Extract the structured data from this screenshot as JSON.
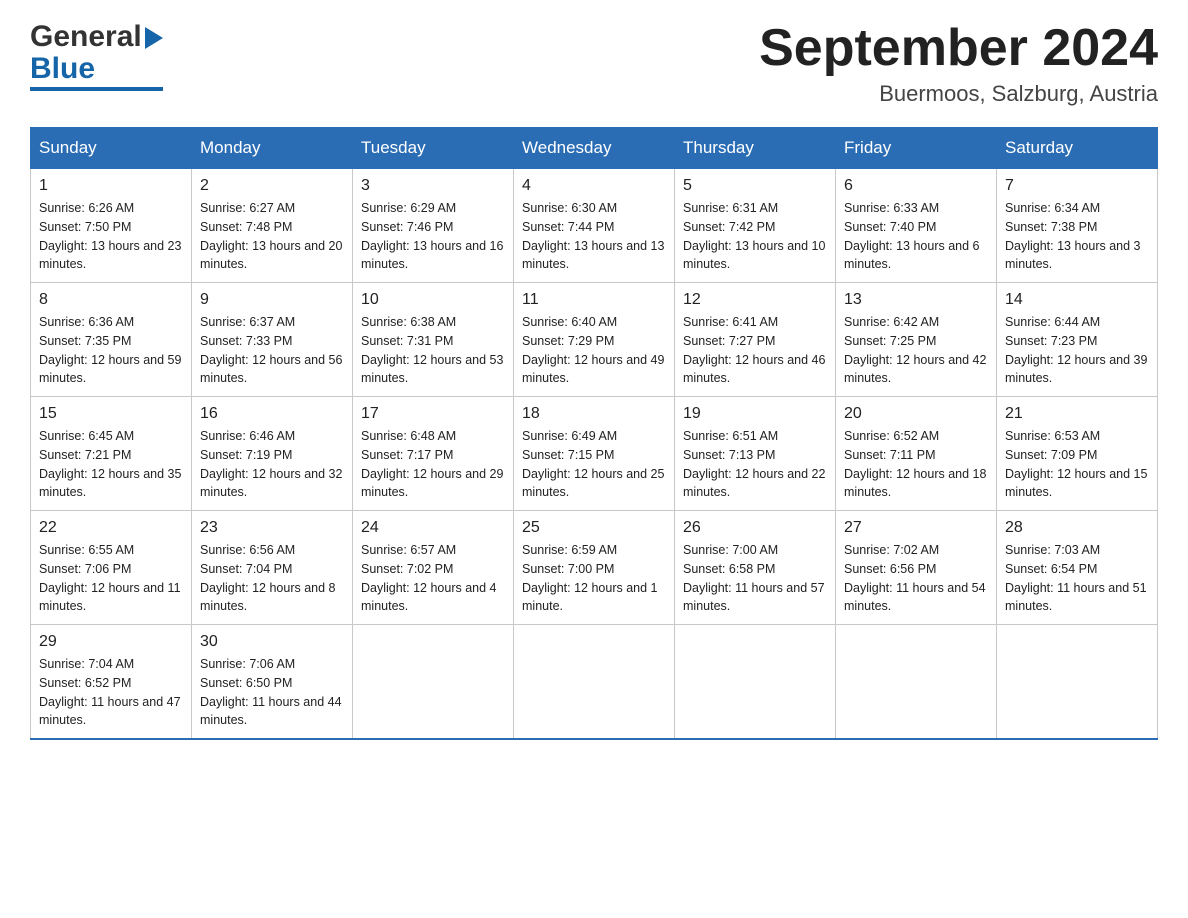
{
  "logo": {
    "general": "General",
    "blue": "Blue"
  },
  "title": "September 2024",
  "subtitle": "Buermoos, Salzburg, Austria",
  "days": [
    "Sunday",
    "Monday",
    "Tuesday",
    "Wednesday",
    "Thursday",
    "Friday",
    "Saturday"
  ],
  "weeks": [
    [
      {
        "num": "1",
        "sunrise": "6:26 AM",
        "sunset": "7:50 PM",
        "daylight": "13 hours and 23 minutes."
      },
      {
        "num": "2",
        "sunrise": "6:27 AM",
        "sunset": "7:48 PM",
        "daylight": "13 hours and 20 minutes."
      },
      {
        "num": "3",
        "sunrise": "6:29 AM",
        "sunset": "7:46 PM",
        "daylight": "13 hours and 16 minutes."
      },
      {
        "num": "4",
        "sunrise": "6:30 AM",
        "sunset": "7:44 PM",
        "daylight": "13 hours and 13 minutes."
      },
      {
        "num": "5",
        "sunrise": "6:31 AM",
        "sunset": "7:42 PM",
        "daylight": "13 hours and 10 minutes."
      },
      {
        "num": "6",
        "sunrise": "6:33 AM",
        "sunset": "7:40 PM",
        "daylight": "13 hours and 6 minutes."
      },
      {
        "num": "7",
        "sunrise": "6:34 AM",
        "sunset": "7:38 PM",
        "daylight": "13 hours and 3 minutes."
      }
    ],
    [
      {
        "num": "8",
        "sunrise": "6:36 AM",
        "sunset": "7:35 PM",
        "daylight": "12 hours and 59 minutes."
      },
      {
        "num": "9",
        "sunrise": "6:37 AM",
        "sunset": "7:33 PM",
        "daylight": "12 hours and 56 minutes."
      },
      {
        "num": "10",
        "sunrise": "6:38 AM",
        "sunset": "7:31 PM",
        "daylight": "12 hours and 53 minutes."
      },
      {
        "num": "11",
        "sunrise": "6:40 AM",
        "sunset": "7:29 PM",
        "daylight": "12 hours and 49 minutes."
      },
      {
        "num": "12",
        "sunrise": "6:41 AM",
        "sunset": "7:27 PM",
        "daylight": "12 hours and 46 minutes."
      },
      {
        "num": "13",
        "sunrise": "6:42 AM",
        "sunset": "7:25 PM",
        "daylight": "12 hours and 42 minutes."
      },
      {
        "num": "14",
        "sunrise": "6:44 AM",
        "sunset": "7:23 PM",
        "daylight": "12 hours and 39 minutes."
      }
    ],
    [
      {
        "num": "15",
        "sunrise": "6:45 AM",
        "sunset": "7:21 PM",
        "daylight": "12 hours and 35 minutes."
      },
      {
        "num": "16",
        "sunrise": "6:46 AM",
        "sunset": "7:19 PM",
        "daylight": "12 hours and 32 minutes."
      },
      {
        "num": "17",
        "sunrise": "6:48 AM",
        "sunset": "7:17 PM",
        "daylight": "12 hours and 29 minutes."
      },
      {
        "num": "18",
        "sunrise": "6:49 AM",
        "sunset": "7:15 PM",
        "daylight": "12 hours and 25 minutes."
      },
      {
        "num": "19",
        "sunrise": "6:51 AM",
        "sunset": "7:13 PM",
        "daylight": "12 hours and 22 minutes."
      },
      {
        "num": "20",
        "sunrise": "6:52 AM",
        "sunset": "7:11 PM",
        "daylight": "12 hours and 18 minutes."
      },
      {
        "num": "21",
        "sunrise": "6:53 AM",
        "sunset": "7:09 PM",
        "daylight": "12 hours and 15 minutes."
      }
    ],
    [
      {
        "num": "22",
        "sunrise": "6:55 AM",
        "sunset": "7:06 PM",
        "daylight": "12 hours and 11 minutes."
      },
      {
        "num": "23",
        "sunrise": "6:56 AM",
        "sunset": "7:04 PM",
        "daylight": "12 hours and 8 minutes."
      },
      {
        "num": "24",
        "sunrise": "6:57 AM",
        "sunset": "7:02 PM",
        "daylight": "12 hours and 4 minutes."
      },
      {
        "num": "25",
        "sunrise": "6:59 AM",
        "sunset": "7:00 PM",
        "daylight": "12 hours and 1 minute."
      },
      {
        "num": "26",
        "sunrise": "7:00 AM",
        "sunset": "6:58 PM",
        "daylight": "11 hours and 57 minutes."
      },
      {
        "num": "27",
        "sunrise": "7:02 AM",
        "sunset": "6:56 PM",
        "daylight": "11 hours and 54 minutes."
      },
      {
        "num": "28",
        "sunrise": "7:03 AM",
        "sunset": "6:54 PM",
        "daylight": "11 hours and 51 minutes."
      }
    ],
    [
      {
        "num": "29",
        "sunrise": "7:04 AM",
        "sunset": "6:52 PM",
        "daylight": "11 hours and 47 minutes."
      },
      {
        "num": "30",
        "sunrise": "7:06 AM",
        "sunset": "6:50 PM",
        "daylight": "11 hours and 44 minutes."
      },
      null,
      null,
      null,
      null,
      null
    ]
  ]
}
